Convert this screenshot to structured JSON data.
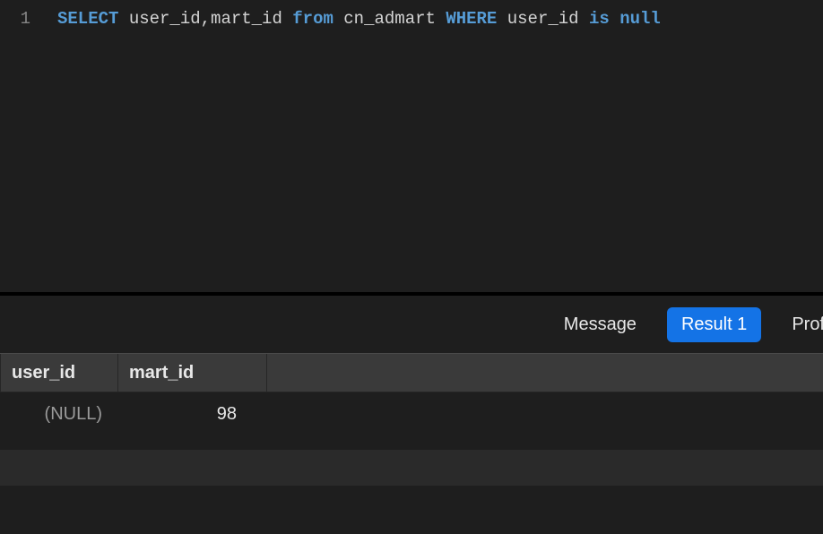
{
  "editor": {
    "line_number": "1",
    "tokens": {
      "select": "SELECT",
      "cols": "user_id,mart_id",
      "from": "from",
      "table": "cn_admart",
      "where": "WHERE",
      "wcol": "user_id",
      "is": "is",
      "null": "null"
    }
  },
  "tabs": {
    "message": "Message",
    "result1": "Result 1",
    "profile": "Prof"
  },
  "results": {
    "columns": {
      "user_id": "user_id",
      "mart_id": "mart_id"
    },
    "rows": [
      {
        "user_id": "(NULL)",
        "mart_id": "98"
      }
    ]
  }
}
